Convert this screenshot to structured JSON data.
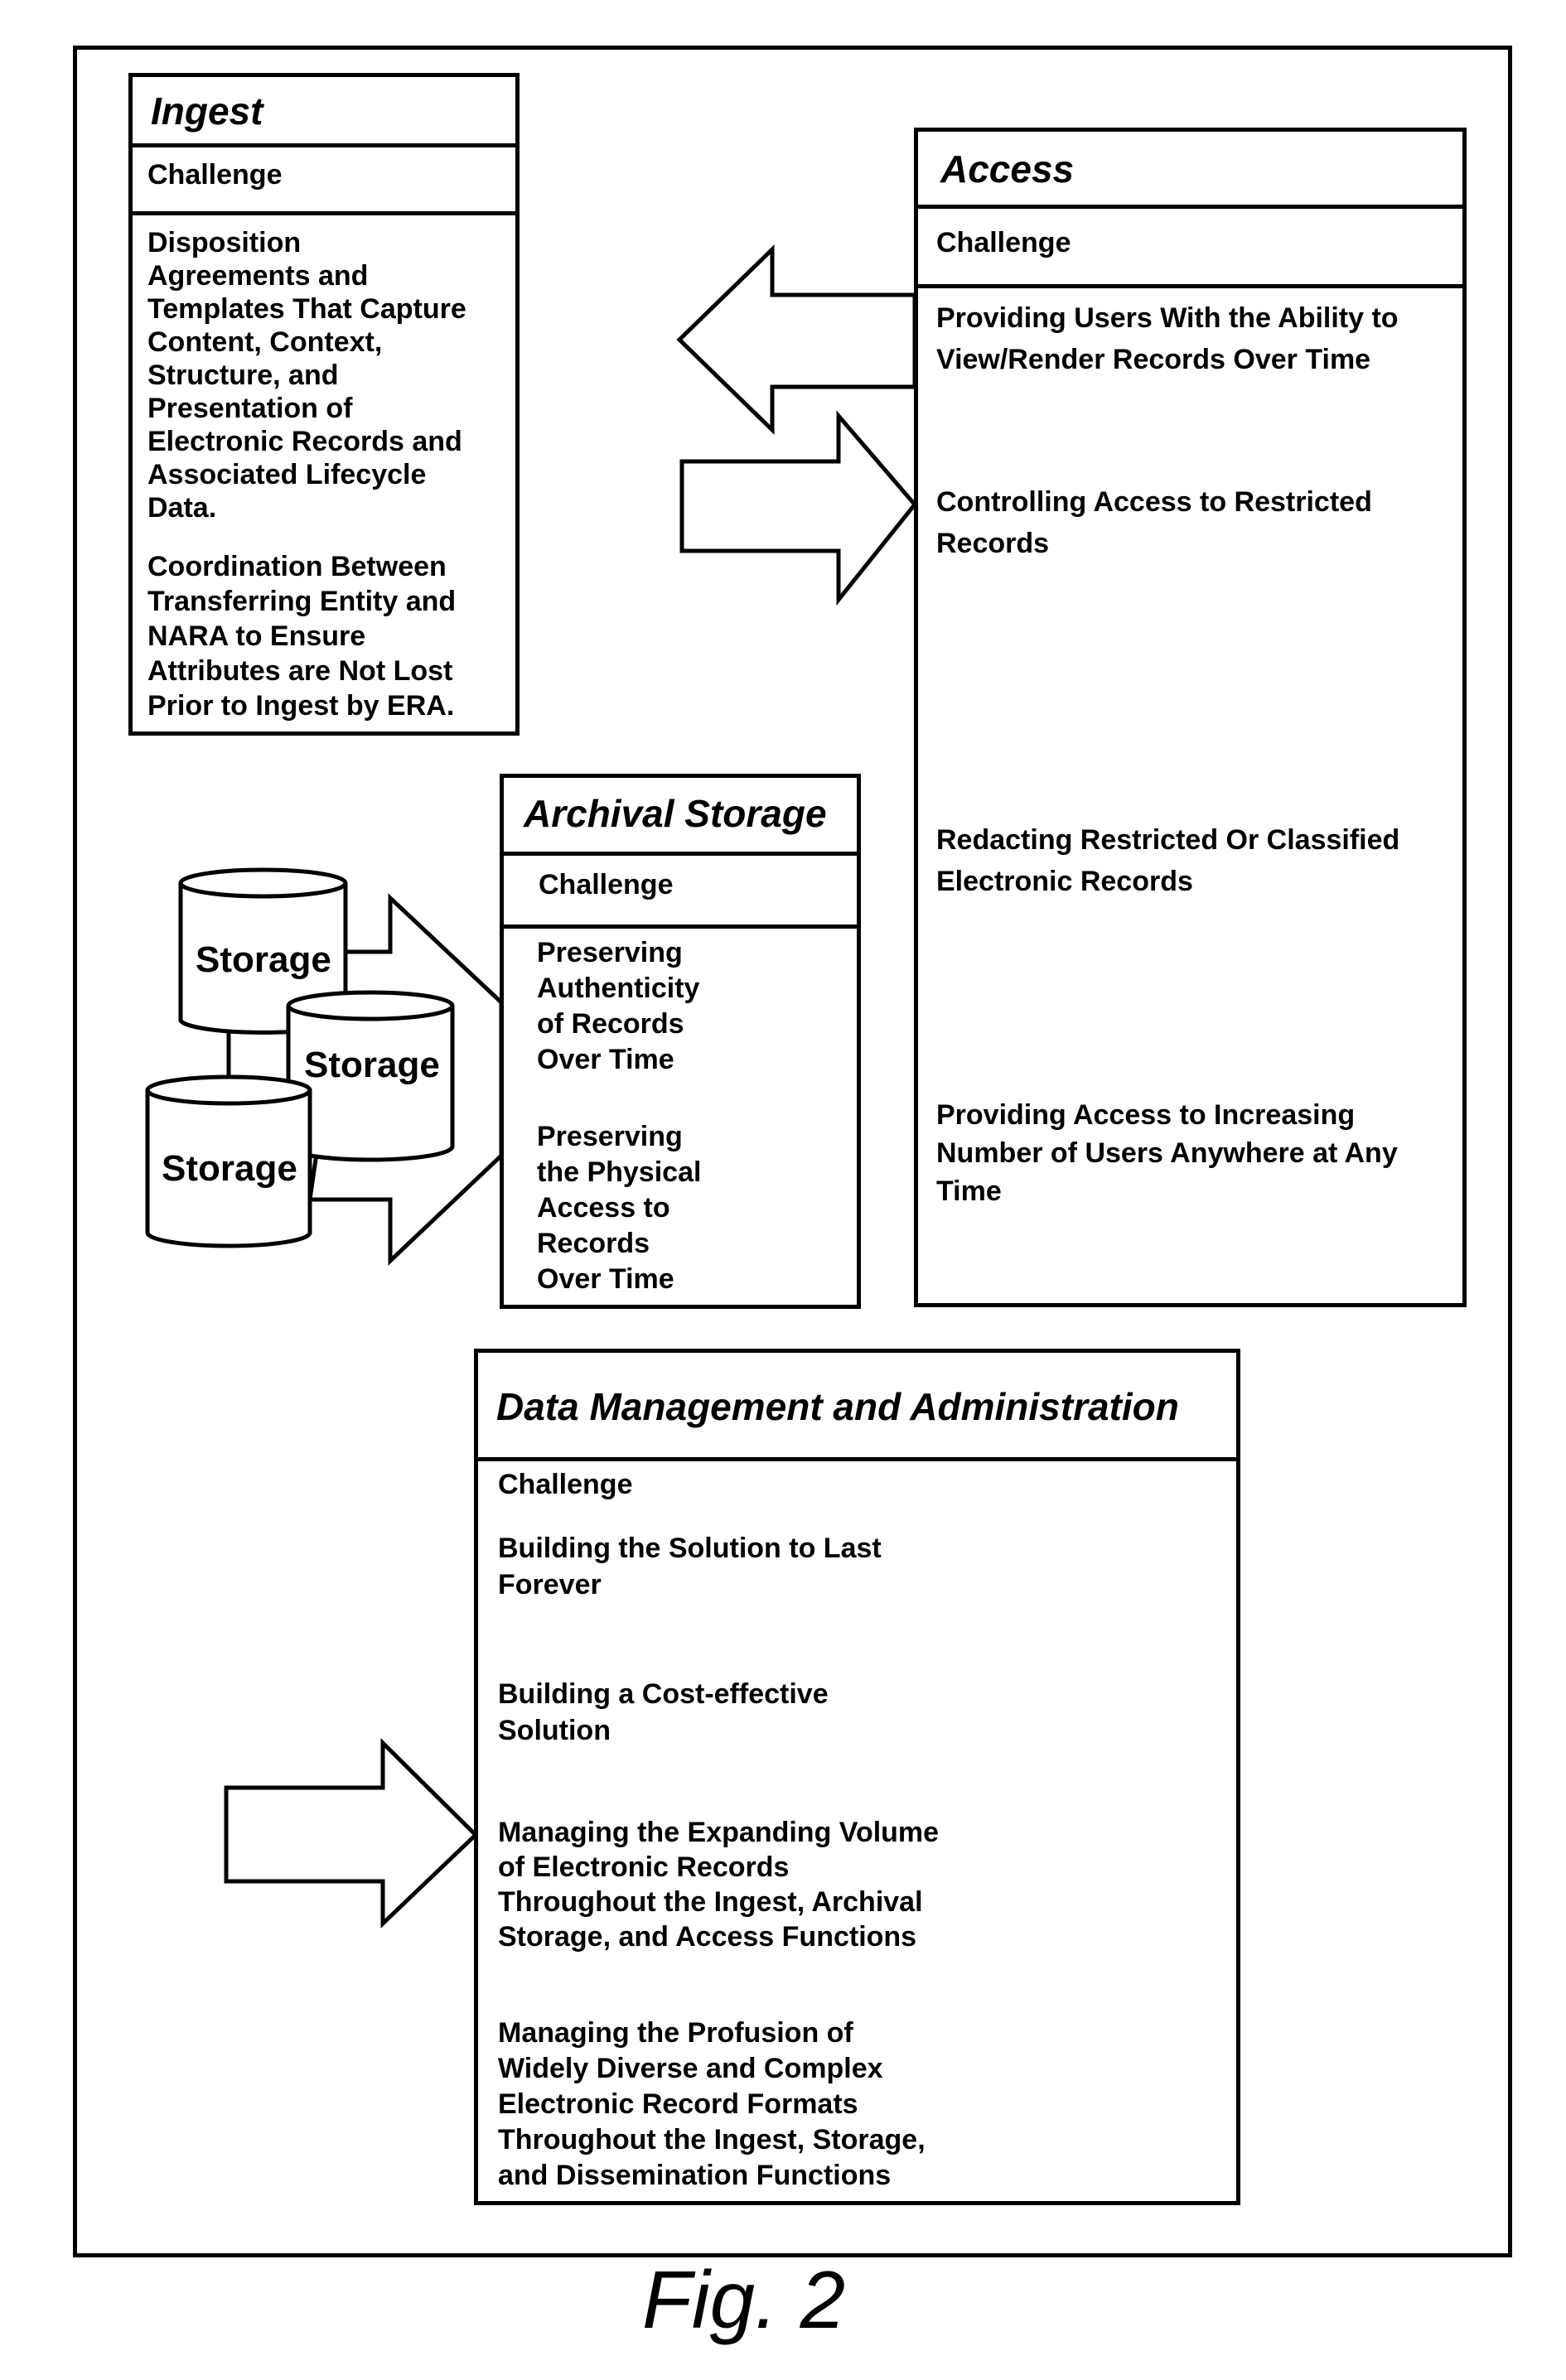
{
  "ingest": {
    "title": "Ingest",
    "challenge_label": "Challenge",
    "items": [
      {
        "lines": [
          "Disposition",
          "Agreements and",
          "Templates That Capture",
          "Content, Context,",
          "Structure, and",
          "Presentation of",
          "Electronic Records and",
          "Associated Lifecycle",
          "Data."
        ]
      },
      {
        "lines": [
          "Coordination Between",
          "Transferring Entity and",
          "NARA to Ensure",
          "Attributes are Not Lost",
          "Prior to Ingest by ERA."
        ]
      }
    ]
  },
  "access": {
    "title": "Access",
    "challenge_label": "Challenge",
    "items": [
      {
        "lines": [
          "Providing Users With the Ability to",
          "View/Render Records Over Time"
        ]
      },
      {
        "lines": [
          "Controlling Access to Restricted",
          "Records"
        ]
      },
      {
        "lines": [
          "Redacting Restricted Or Classified",
          "Electronic Records"
        ]
      },
      {
        "lines": [
          "Providing Access to Increasing",
          "Number of Users Anywhere at Any",
          "Time"
        ]
      }
    ]
  },
  "archival_storage": {
    "title": "Archival Storage",
    "challenge_label": "Challenge",
    "items": [
      {
        "lines": [
          "Preserving",
          "Authenticity",
          "of Records",
          "Over Time"
        ]
      },
      {
        "lines": [
          "Preserving",
          "the Physical",
          "Access to",
          "Records",
          "Over Time"
        ]
      }
    ]
  },
  "storage_cylinders": [
    "Storage",
    "Storage",
    "Storage"
  ],
  "data_management": {
    "title": "Data Management and Administration",
    "challenge_label": "Challenge",
    "items": [
      {
        "lines": [
          "Building the Solution to Last",
          "Forever"
        ]
      },
      {
        "lines": [
          "Building a Cost-effective",
          "Solution"
        ]
      },
      {
        "lines": [
          "Managing the Expanding Volume",
          "of Electronic Records",
          "Throughout the Ingest, Archival",
          "Storage, and Access Functions"
        ]
      },
      {
        "lines": [
          "Managing the Profusion of",
          "Widely Diverse and Complex",
          "Electronic Record Formats",
          "Throughout the Ingest, Storage,",
          "and Dissemination Functions"
        ]
      }
    ]
  },
  "arrows": [
    {
      "name": "access-to-ingest",
      "direction": "left"
    },
    {
      "name": "into-access",
      "direction": "right"
    },
    {
      "name": "storage-to-archival",
      "direction": "right"
    },
    {
      "name": "into-data-management",
      "direction": "right"
    }
  ],
  "figure_label": "Fig. 2",
  "colors": {
    "ink": "#000000",
    "paper": "#ffffff"
  }
}
